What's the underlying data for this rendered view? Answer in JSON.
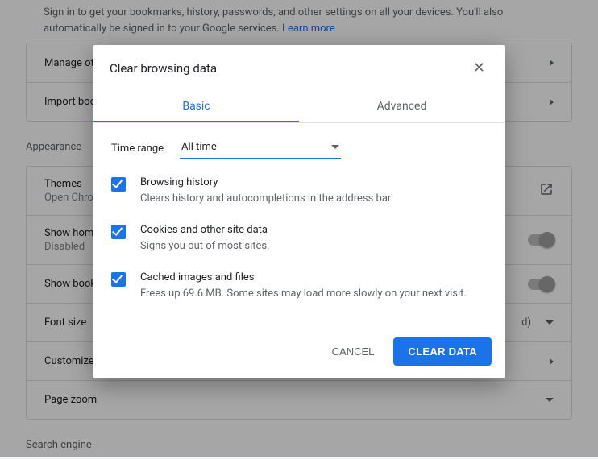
{
  "signin_desc_1": "Sign in to get your bookmarks, history, passwords, and other settings on all your devices. You'll also",
  "signin_desc_2": "automatically be signed in to your Google services.",
  "learn_more": "Learn more",
  "sections": {
    "people_rows": {
      "manage": "Manage ot",
      "import": "Import boo"
    },
    "appearance_header": "Appearance",
    "appearance": {
      "themes": "Themes",
      "themes_sub": "Open Chro",
      "show_home": "Show home",
      "show_home_sub": "Disabled",
      "show_book": "Show book",
      "font_size": "Font size",
      "font_recommended": "d)",
      "customize": "Customize",
      "page_zoom": "Page zoom"
    },
    "search_header": "Search engine"
  },
  "dialog": {
    "title": "Clear browsing data",
    "tabs": {
      "basic": "Basic",
      "advanced": "Advanced"
    },
    "time_label": "Time range",
    "time_value": "All time",
    "options": [
      {
        "title": "Browsing history",
        "desc": "Clears history and autocompletions in the address bar."
      },
      {
        "title": "Cookies and other site data",
        "desc": "Signs you out of most sites."
      },
      {
        "title": "Cached images and files",
        "desc": "Frees up 69.6 MB. Some sites may load more slowly on your next visit."
      }
    ],
    "actions": {
      "cancel": "CANCEL",
      "clear": "CLEAR DATA"
    }
  }
}
